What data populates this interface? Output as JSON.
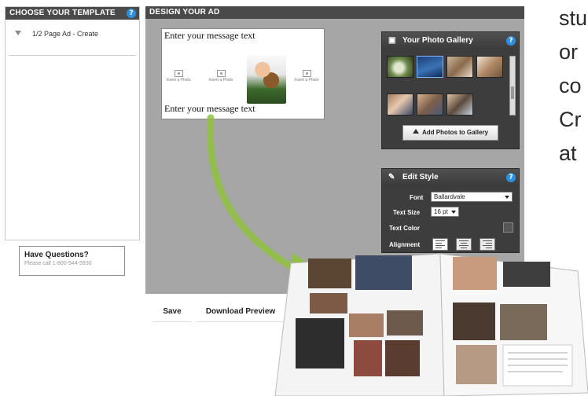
{
  "template_panel": {
    "header": "CHOOSE YOUR TEMPLATE",
    "items": [
      {
        "label": "1/2 Page Ad - Create"
      }
    ]
  },
  "questions": {
    "title": "Have Questions?",
    "subtitle": "Please call 1-800-944-5930"
  },
  "design_panel": {
    "header": "DESIGN YOUR AD",
    "canvas": {
      "message_top": "Enter your message text",
      "message_bottom": "Enter your message text",
      "insert_photo_label": "Insert a Photo"
    },
    "gallery": {
      "title": "Your Photo Gallery",
      "add_button": "Add Photos to Gallery"
    },
    "edit_style": {
      "title": "Edit Style",
      "font_label": "Font",
      "font_value": "Ballardvale",
      "size_label": "Text Size",
      "size_value": "16 pt",
      "color_label": "Text Color",
      "alignment_label": "Alignment"
    }
  },
  "actions": {
    "save": "Save",
    "download_preview": "Download Preview"
  },
  "promo_text": [
    "stu",
    "or",
    "co",
    "Cr",
    "at"
  ],
  "colors": {
    "panel_header": "#4a4a4a",
    "help_icon": "#2d8fe0",
    "design_bg": "#a6a6a6",
    "dark_panel": "#3d3d3d",
    "arrow": "#8fc13f"
  }
}
